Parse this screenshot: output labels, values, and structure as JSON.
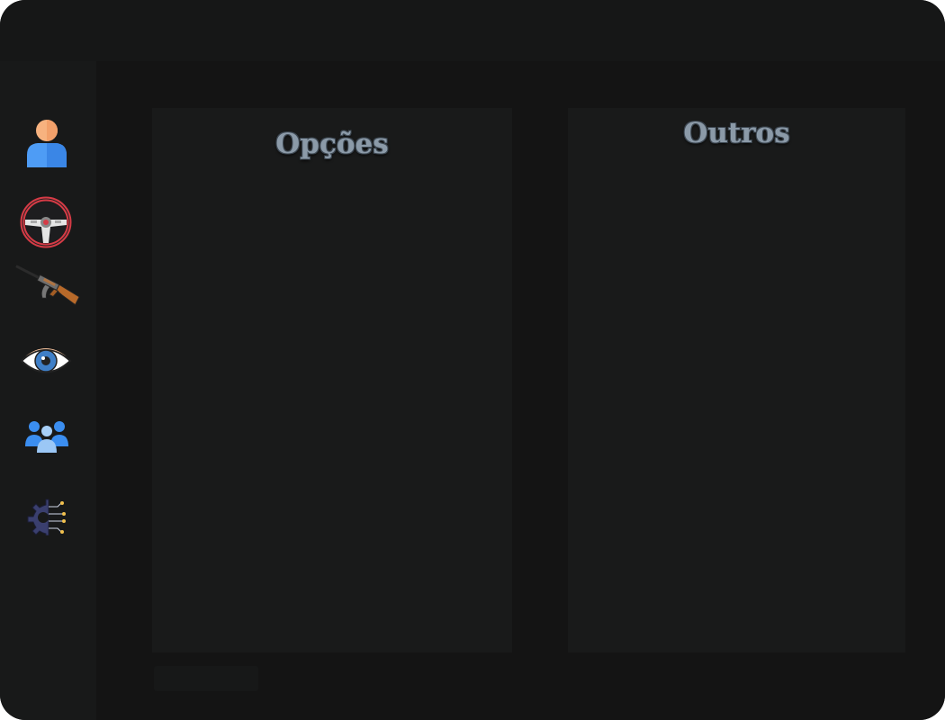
{
  "panels": {
    "left": {
      "title": "Opções"
    },
    "right": {
      "title": "Outros"
    }
  },
  "sidebar": {
    "items": [
      {
        "id": "player",
        "icon": "user-icon"
      },
      {
        "id": "vehicle",
        "icon": "steering-wheel-icon"
      },
      {
        "id": "weapons",
        "icon": "rifle-icon"
      },
      {
        "id": "visuals",
        "icon": "eye-icon"
      },
      {
        "id": "players",
        "icon": "group-icon"
      },
      {
        "id": "settings",
        "icon": "gear-circuit-icon"
      }
    ]
  },
  "colors": {
    "background": "#151616",
    "panel": "#191a1a",
    "title_text": "#8b9aa8",
    "accent_blue": "#3b8ef0",
    "accent_red": "#d63b46"
  }
}
